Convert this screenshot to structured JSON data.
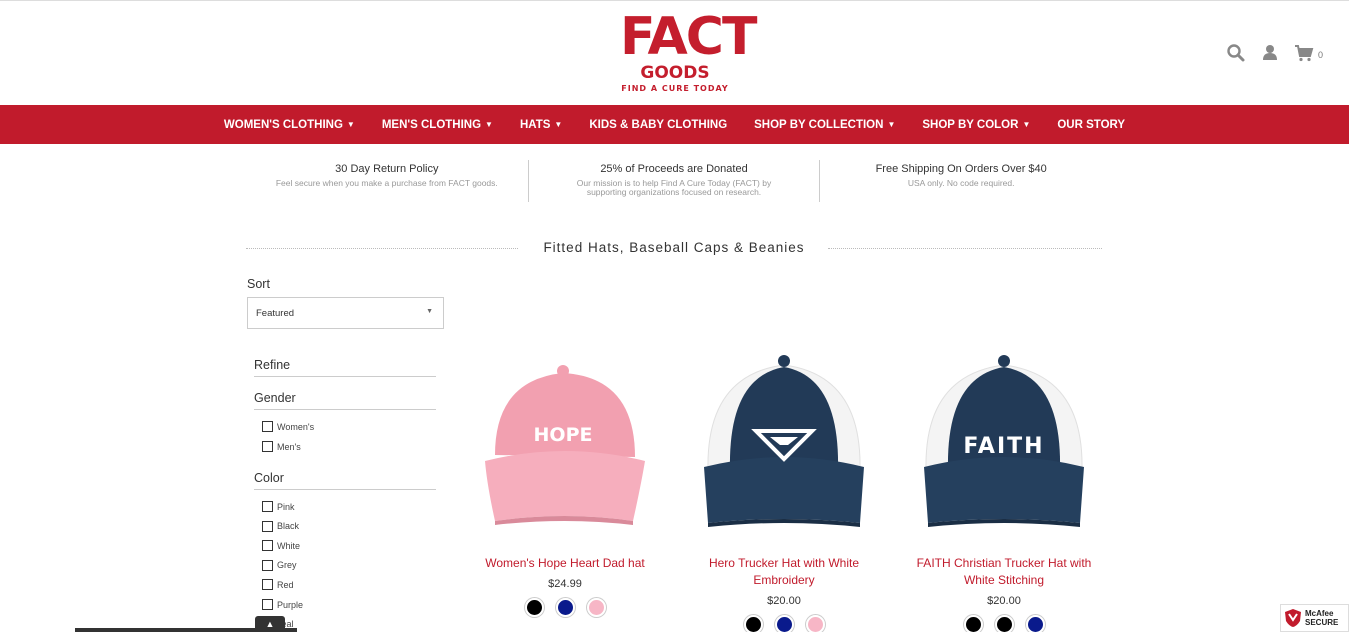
{
  "header": {
    "logo_main": "FACT",
    "logo_sub": "GOODS",
    "logo_tag": "FIND A CURE TODAY",
    "cart_count": "0"
  },
  "nav": {
    "items": [
      {
        "label": "WOMEN'S CLOTHING",
        "has_caret": true
      },
      {
        "label": "MEN'S CLOTHING",
        "has_caret": true
      },
      {
        "label": "HATS",
        "has_caret": true
      },
      {
        "label": "KIDS & BABY CLOTHING",
        "has_caret": false
      },
      {
        "label": "SHOP BY COLLECTION",
        "has_caret": true
      },
      {
        "label": "SHOP BY COLOR",
        "has_caret": true
      },
      {
        "label": "OUR STORY",
        "has_caret": false
      }
    ]
  },
  "info": [
    {
      "title": "30 Day Return Policy",
      "sub": "Feel secure when you make a purchase from FACT goods."
    },
    {
      "title": "25% of Proceeds are Donated",
      "sub": "Our mission is to help Find A Cure Today (FACT) by supporting organizations focused on research."
    },
    {
      "title": "Free Shipping On Orders Over $40",
      "sub": "USA only. No code required."
    }
  ],
  "collection_title": "Fitted Hats, Baseball Caps & Beanies",
  "sidebar": {
    "sort_label": "Sort",
    "sort_value": "Featured",
    "refine_label": "Refine",
    "gender_label": "Gender",
    "gender_options": [
      "Women's",
      "Men's"
    ],
    "color_label": "Color",
    "color_options": [
      "Pink",
      "Black",
      "White",
      "Grey",
      "Red",
      "Purple",
      "Teal"
    ]
  },
  "products": [
    {
      "name": "Women's Hope Heart Dad hat",
      "price": "$24.99",
      "cap_text": "HOPE",
      "swatches": [
        "#000000",
        "#0a1a8c",
        "#f7b6c6"
      ]
    },
    {
      "name": "Hero Trucker Hat with White Embroidery",
      "price": "$20.00",
      "cap_text": "",
      "swatches": [
        "#000000",
        "#0a1a8c",
        "#f7b6c6"
      ]
    },
    {
      "name": "FAITH Christian Trucker Hat with White Stitching",
      "price": "$20.00",
      "cap_text": "FAITH",
      "swatches": [
        "#000000",
        "#000000",
        "#0a1a8c"
      ]
    }
  ],
  "badges": {
    "mcafee_1": "McAfee",
    "mcafee_2": "SECURE"
  },
  "colors": {
    "brand_red": "#c11b2c",
    "navy": "#223a57",
    "pink_cap": "#f2a0b0"
  }
}
